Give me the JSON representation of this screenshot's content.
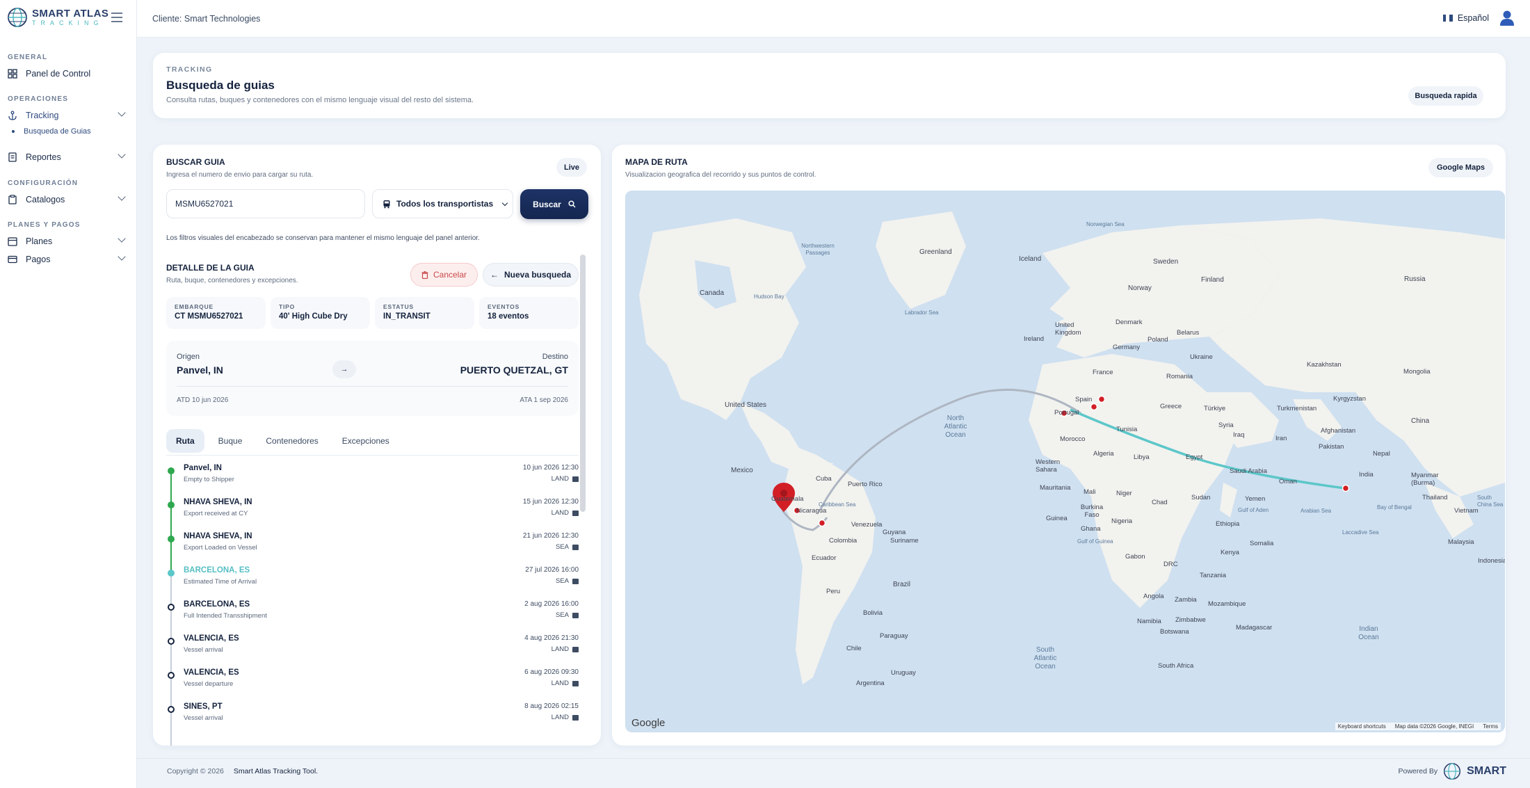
{
  "brand": {
    "name": "SMART ATLAS",
    "tagline": "TRACKING"
  },
  "topbar": {
    "client": "Cliente: Smart Technologies",
    "language": "Español"
  },
  "sidebar": {
    "sections": [
      {
        "title": "GENERAL"
      },
      {
        "title": "OPERACIONES"
      },
      {
        "title": "CONFIGURACIÓN"
      },
      {
        "title": "PLANES Y PAGOS"
      }
    ],
    "items": {
      "panel": "Panel de Control",
      "tracking": "Tracking",
      "tracking_sub": "Busqueda de Guias",
      "reportes": "Reportes",
      "catalogos": "Catalogos",
      "planes": "Planes",
      "pagos": "Pagos"
    }
  },
  "hero": {
    "eyebrow": "TRACKING",
    "title": "Busqueda de guias",
    "subtitle": "Consulta rutas, buques y contenedores con el mismo lenguaje visual del resto del sistema.",
    "quick_button": "Busqueda rapida"
  },
  "search": {
    "title": "BUSCAR GUIA",
    "subtitle": "Ingresa el numero de envio para cargar su ruta.",
    "badge": "Live",
    "input_value": "MSMU6527021",
    "carrier_select": "Todos los transportistas",
    "search_button": "Buscar",
    "note": "Los filtros visuales del encabezado se conservan para mantener el mismo lenguaje del panel anterior."
  },
  "detail": {
    "title": "DETALLE DE LA GUIA",
    "subtitle": "Ruta, buque, contenedores y excepciones.",
    "cancel_button": "Cancelar",
    "new_search_button": "Nueva busqueda",
    "kpis": [
      {
        "label": "EMBARQUE",
        "value": "CT MSMU6527021"
      },
      {
        "label": "TIPO",
        "value": "40' High Cube Dry"
      },
      {
        "label": "ESTATUS",
        "value": "IN_TRANSIT"
      },
      {
        "label": "EVENTOS",
        "value": "18 eventos"
      }
    ],
    "origin_label": "Origen",
    "origin": "Panvel, IN",
    "dest_label": "Destino",
    "dest": "PUERTO QUETZAL, GT",
    "atd": "ATD 10 jun 2026",
    "ata": "ATA 1 sep 2026",
    "tabs": [
      "Ruta",
      "Buque",
      "Contenedores",
      "Excepciones"
    ],
    "events": [
      {
        "city": "Panvel, IN",
        "desc": "Empty to Shipper",
        "date": "10 jun 2026 12:30",
        "mode": "LAND",
        "state": "done"
      },
      {
        "city": "NHAVA SHEVA, IN",
        "desc": "Export received at CY",
        "date": "15 jun 2026 12:30",
        "mode": "LAND",
        "state": "done"
      },
      {
        "city": "NHAVA SHEVA, IN",
        "desc": "Export Loaded on Vessel",
        "date": "21 jun 2026 12:30",
        "mode": "SEA",
        "state": "done"
      },
      {
        "city": "BARCELONA, ES",
        "desc": "Estimated Time of Arrival",
        "date": "27 jul 2026 16:00",
        "mode": "SEA",
        "state": "active"
      },
      {
        "city": "BARCELONA, ES",
        "desc": "Full Intended Transshipment",
        "date": "2 aug 2026 16:00",
        "mode": "SEA",
        "state": "pending"
      },
      {
        "city": "VALENCIA, ES",
        "desc": "Vessel arrival",
        "date": "4 aug 2026 21:30",
        "mode": "LAND",
        "state": "pending"
      },
      {
        "city": "VALENCIA, ES",
        "desc": "Vessel departure",
        "date": "6 aug 2026 09:30",
        "mode": "LAND",
        "state": "pending"
      },
      {
        "city": "SINES, PT",
        "desc": "Vessel arrival",
        "date": "8 aug 2026 02:15",
        "mode": "LAND",
        "state": "pending"
      }
    ]
  },
  "map": {
    "title": "MAPA DE RUTA",
    "subtitle": "Visualizacion geografica del recorrido y sus puntos de control.",
    "button": "Google Maps",
    "attribution": {
      "logo": "Google",
      "shortcuts": "Keyboard shortcuts",
      "data": "Map data ©2026 Google, INEGI",
      "terms": "Terms"
    },
    "labels": {
      "greenland": "Greenland",
      "iceland": "Iceland",
      "sweden": "Sweden",
      "finland": "Finland",
      "norway": "Norway",
      "russia": "Russia",
      "canada": "Canada",
      "hudson": "Hudson Bay",
      "labrador": "Labrador Sea",
      "uk": "United Kingdom",
      "ireland": "Ireland",
      "denmark": "Denmark",
      "germany": "Germany",
      "poland": "Poland",
      "belarus": "Belarus",
      "ukraine": "Ukraine",
      "france": "France",
      "romania": "Romania",
      "kazakhstan": "Kazakhstan",
      "mongolia": "Mongolia",
      "us": "United States",
      "spain": "Spain",
      "portugal": "Portugal",
      "greece": "Greece",
      "turkiye": "Türkiye",
      "turkmenistan": "Turkmenistan",
      "kyrgyzstan": "Kyrgyzstan",
      "china": "China",
      "north_atlantic": "North Atlantic Ocean",
      "tunisia": "Tunisia",
      "syria": "Syria",
      "iraq": "Iraq",
      "iran": "Iran",
      "afghanistan": "Afghanistan",
      "pakistan": "Pakistan",
      "nepal": "Nepal",
      "morocco": "Morocco",
      "algeria": "Algeria",
      "libya": "Libya",
      "egypt": "Egypt",
      "saudi": "Saudi Arabia",
      "oman": "Oman",
      "india": "India",
      "myanmar": "Myanmar (Burma)",
      "thailand": "Thailand",
      "vietnam": "Vietnam",
      "mexico": "Mexico",
      "cuba": "Cuba",
      "puerto_rico": "Puerto Rico",
      "guatemala": "Guatemala",
      "nicaragua": "Nicaragua",
      "venezuela": "Venezuela",
      "colombia": "Colombia",
      "guyana": "Guyana",
      "suriname": "Suriname",
      "ecuador": "Ecuador",
      "peru": "Peru",
      "brazil": "Brazil",
      "bolivia": "Bolivia",
      "paraguay": "Paraguay",
      "chile": "Chile",
      "uruguay": "Uruguay",
      "argentina": "Argentina",
      "western_sahara": "Western Sahara",
      "mauritania": "Mauritania",
      "mali": "Mali",
      "niger": "Niger",
      "chad": "Chad",
      "sudan": "Sudan",
      "yemen": "Yemen",
      "ethiopia": "Ethiopia",
      "somalia": "Somalia",
      "kenya": "Kenya",
      "burkina": "Burkina Faso",
      "guinea": "Guinea",
      "ghana": "Ghana",
      "nigeria": "Nigeria",
      "gabon": "Gabon",
      "drc": "DRC",
      "tanzania": "Tanzania",
      "angola": "Angola",
      "zambia": "Zambia",
      "mozambique": "Mozambique",
      "namibia": "Namibia",
      "zimbabwe": "Zimbabwe",
      "botswana": "Botswana",
      "madagascar": "Madagascar",
      "south_africa": "South Africa",
      "south_atlantic": "South Atlantic Ocean",
      "indian_ocean": "Indian Ocean",
      "malaysia": "Malaysia",
      "indonesia": "Indonesia",
      "norwegian_sea": "Norwegian Sea",
      "caribbean": "Caribbean Sea",
      "arabian_sea": "Arabian Sea",
      "bay_bengal": "Bay of Bengal",
      "gulf_aden": "Gulf of Aden",
      "gulf_guinea": "Gulf of Guinea",
      "laccadive": "Laccadive Sea",
      "south_china": "South China Sea",
      "nw_passages": "Northwestern Passages"
    }
  },
  "footer": {
    "copyright": "Copyright © 2026",
    "tool": "Smart Atlas Tracking Tool.",
    "powered": "Powered By",
    "brand": "SMART"
  },
  "colors": {
    "navy": "#14223d",
    "route_teal": "#5cc7c9",
    "route_gray": "#aeb6c2",
    "marker_red": "#d21f26",
    "done_green": "#2fa84f"
  }
}
